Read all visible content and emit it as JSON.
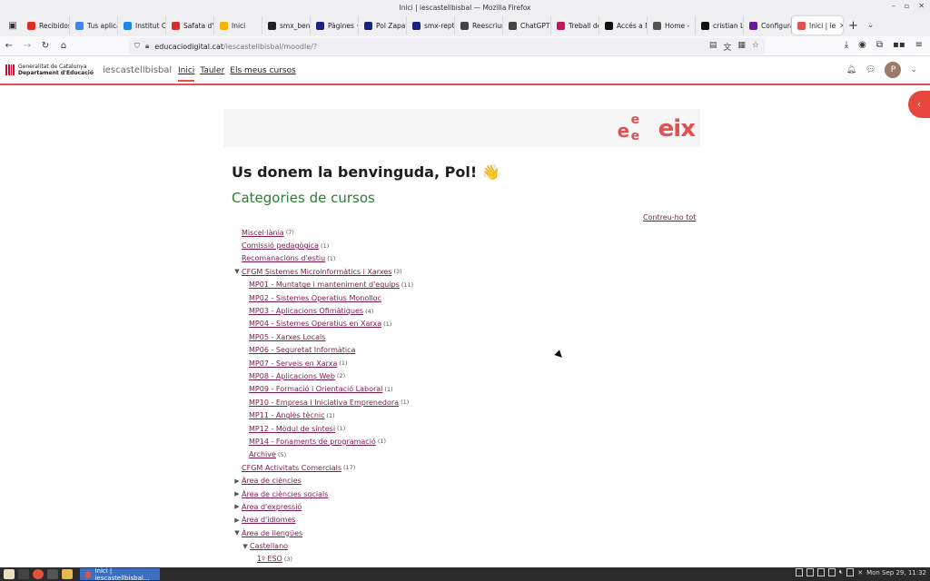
{
  "window": {
    "title": "Inici | iescastellbisbal — Mozilla Firefox"
  },
  "tabs": [
    {
      "label": "Recibidos",
      "color": "#d93025"
    },
    {
      "label": "Tus aplicac",
      "color": "#4285f4"
    },
    {
      "label": "Institut Ca",
      "color": "#1e88e5"
    },
    {
      "label": "Safata d'e",
      "color": "#d93025"
    },
    {
      "label": "Inici",
      "color": "#f4b400"
    },
    {
      "label": "smx_benv",
      "color": "#222222"
    },
    {
      "label": "Pàgines ·",
      "color": "#1a237e"
    },
    {
      "label": "Pol Zapata",
      "color": "#1a237e"
    },
    {
      "label": "smx-repte",
      "color": "#1a237e"
    },
    {
      "label": "Reescriure",
      "color": "#444444"
    },
    {
      "label": "ChatGPT",
      "color": "#444444"
    },
    {
      "label": "Treball de",
      "color": "#c2185b"
    },
    {
      "label": "Accés a Mo",
      "color": "#111111"
    },
    {
      "label": "Home -",
      "color": "#555555"
    },
    {
      "label": "cristian Lo",
      "color": "#111111"
    },
    {
      "label": "Configura",
      "color": "#6a1b9a"
    },
    {
      "label": "Inici | ie",
      "color": "#e25050",
      "active": true
    }
  ],
  "url": {
    "host": "educaciodigital.cat",
    "rest": "/iescastellbisbal/moodle/?"
  },
  "header": {
    "gencat_line1": "Generalitat de Catalunya",
    "gencat_line2": "Departament d'Educació",
    "site_name": "iescastellbisbal",
    "nav": [
      "Inici",
      "Tauler",
      "Els meus cursos"
    ],
    "avatar_letter": "P"
  },
  "banner": {
    "logo_text": "eix"
  },
  "main": {
    "welcome": "Us donem la benvinguda, Pol! 👋",
    "categories_title": "Categories de cursos",
    "collapse_all": "Contreu-ho tot"
  },
  "categories": [
    {
      "label": "Miscel·lània",
      "count": "(7)",
      "level": 0,
      "tri": ""
    },
    {
      "label": "Comissió pedagògica",
      "count": "(1)",
      "level": 0,
      "tri": ""
    },
    {
      "label": "Recomanacions d'estiu",
      "count": "(1)",
      "level": 0,
      "tri": ""
    },
    {
      "label": "CFGM Sistemes Microinformàtics i Xarxes",
      "count": "(3)",
      "level": 0,
      "tri": "open"
    },
    {
      "label": "MP01 - Muntatge i manteniment d'equips",
      "count": "(11)",
      "level": 2,
      "tri": ""
    },
    {
      "label": "MP02 - Sistemes Operatius Monolloc",
      "count": "",
      "level": 2,
      "tri": ""
    },
    {
      "label": "MP03 - Aplicacions Ofimàtiques",
      "count": "(4)",
      "level": 2,
      "tri": ""
    },
    {
      "label": "MP04 - Sistemes Operatius en Xarxa",
      "count": "(1)",
      "level": 2,
      "tri": ""
    },
    {
      "label": "MP05 - Xarxes Locals",
      "count": "",
      "level": 2,
      "tri": ""
    },
    {
      "label": "MP06 - Seguretat Informàtica",
      "count": "",
      "level": 2,
      "tri": ""
    },
    {
      "label": "MP07 - Serveis en Xarxa",
      "count": "(1)",
      "level": 2,
      "tri": ""
    },
    {
      "label": "MP08 - Aplicacions Web",
      "count": "(2)",
      "level": 2,
      "tri": ""
    },
    {
      "label": "MP09 - Formació i Orientació Laboral",
      "count": "(1)",
      "level": 2,
      "tri": ""
    },
    {
      "label": "MP10 - Empresa i Iniciativa Emprenedora",
      "count": "(1)",
      "level": 2,
      "tri": ""
    },
    {
      "label": "MP11 - Anglès tècnic",
      "count": "(1)",
      "level": 2,
      "tri": ""
    },
    {
      "label": "MP12 - Mòdul de síntesi",
      "count": "(1)",
      "level": 2,
      "tri": ""
    },
    {
      "label": "MP14 - Fonaments de programació",
      "count": "(1)",
      "level": 2,
      "tri": ""
    },
    {
      "label": "Archive",
      "count": "(5)",
      "level": 2,
      "tri": ""
    },
    {
      "label": "CFGM Activitats Comercials",
      "count": "(17)",
      "level": 0,
      "tri": ""
    },
    {
      "label": "Àrea de ciències",
      "count": "",
      "level": 0,
      "tri": "closed"
    },
    {
      "label": "Àrea de ciències socials",
      "count": "",
      "level": 0,
      "tri": "closed"
    },
    {
      "label": "Àrea d'expressió",
      "count": "",
      "level": 0,
      "tri": "closed"
    },
    {
      "label": "Àrea d'idiomes",
      "count": "",
      "level": 0,
      "tri": "closed"
    },
    {
      "label": "Àrea de llengües",
      "count": "",
      "level": 0,
      "tri": "open"
    },
    {
      "label": "Castellano",
      "count": "",
      "level": 1,
      "tri": "open"
    },
    {
      "label": "1º ESO",
      "count": "(3)",
      "level": 3,
      "tri": ""
    }
  ],
  "taskbar": {
    "task_label": "Inici | iescastellbisbal...",
    "clock": "Mon Sep 29, 11:32"
  },
  "colors": {
    "accent": "#e25050",
    "link": "#7a1b4d",
    "category_title": "#2e7d32"
  }
}
